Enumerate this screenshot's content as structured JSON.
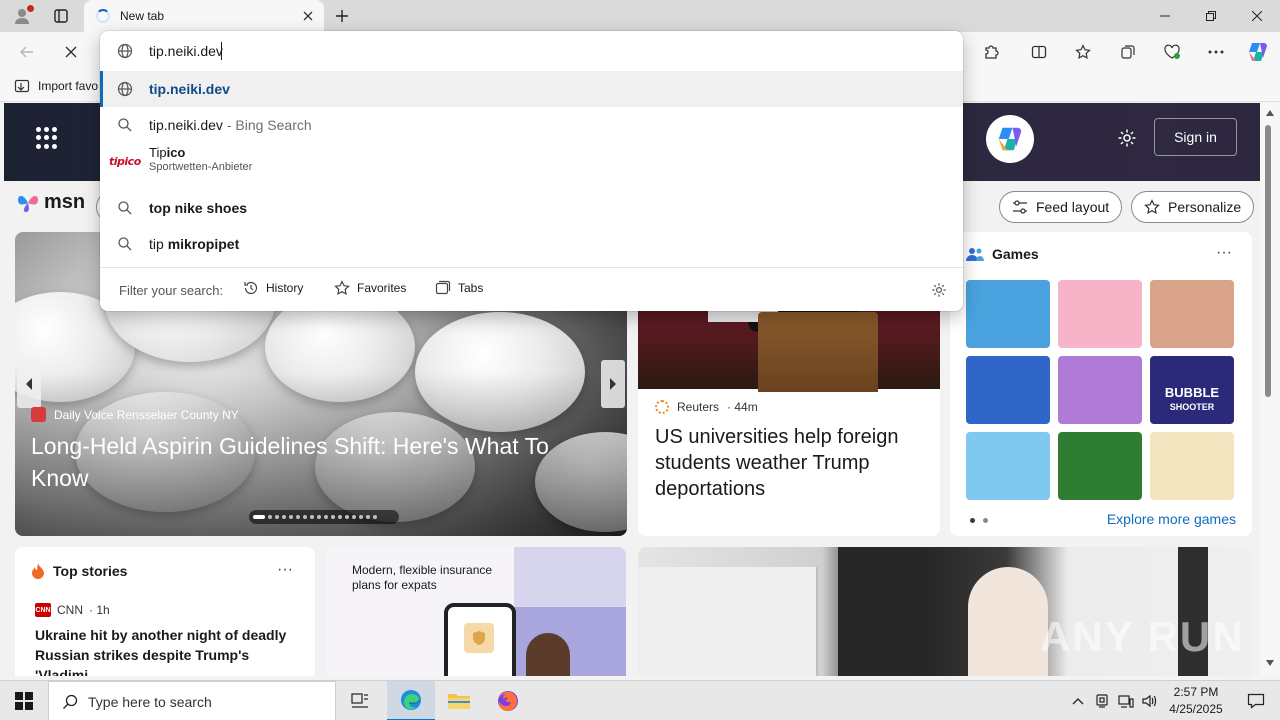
{
  "browser": {
    "tab": {
      "title": "New tab"
    },
    "favorites": {
      "import_label": "Import favo"
    }
  },
  "omnibox": {
    "value": "tip.neiki.dev",
    "suggestions": [
      {
        "main": "tip.neiki.dev",
        "type": "url"
      },
      {
        "main": "tip.neiki.dev",
        "sub": " - Bing Search",
        "type": "search"
      },
      {
        "main_plain": "Tip",
        "main_bold": "ico",
        "secondary": "Sportwetten-Anbieter",
        "logo": "tipico",
        "type": "entity"
      },
      {
        "main_plain": "",
        "main_bold": "top nike shoes",
        "type": "search"
      },
      {
        "main_plain": "tip ",
        "main_bold": "mikropipet",
        "type": "search"
      }
    ],
    "filter": {
      "label": "Filter your search:",
      "chips": [
        "History",
        "Favorites",
        "Tabs"
      ]
    }
  },
  "msn": {
    "logo_text": "msn",
    "signin_label": "Sign in",
    "feed_layout_label": "Feed layout",
    "personalize_label": "Personalize",
    "hero": {
      "source": "Daily Voice Rensselaer County NY",
      "title": "Long-Held Aspirin Guidelines Shift: Here's What To Know"
    },
    "mid": {
      "source": "Reuters",
      "time": " · 44m",
      "title": "US universities help foreign students weather Trump deportations"
    },
    "games": {
      "title": "Games",
      "more": "···",
      "explore_label": "Explore more games",
      "bubble_text": "BUBBLE",
      "shooter_text": "SHOOTER",
      "tile_colors": [
        "#4aa3df",
        "#f7b4c8",
        "#d9a38a",
        "#2f66c7",
        "#b07bd6",
        "#2b2a7a",
        "#7fc8f0",
        "#2e7d32",
        "#f2e5c0"
      ]
    },
    "top_stories": {
      "title": "Top stories",
      "more": "···",
      "source": "CNN",
      "time": " · 1h",
      "headline": "Ukraine hit by another night of deadly Russian strikes despite Trump's 'Vladimi..."
    },
    "ad": {
      "text": "Modern, flexible insurance plans for expats"
    },
    "big_card": {
      "watermark": "ANY RUN"
    }
  },
  "taskbar": {
    "search_placeholder": "Type here to search",
    "time": "2:57 PM",
    "date": "4/25/2025"
  },
  "colors": {
    "accent": "#0f6cbd",
    "omnibox_link": "#114a8b",
    "tipico_red": "#c8102e"
  }
}
